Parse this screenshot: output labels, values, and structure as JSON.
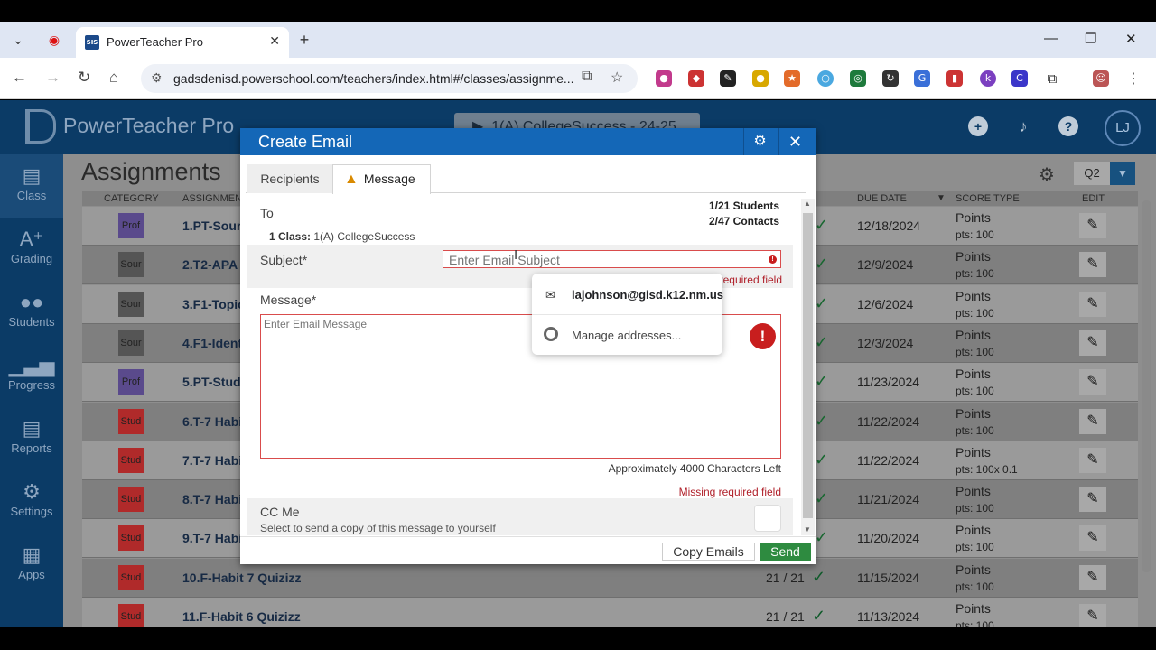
{
  "browser": {
    "tab_title": "PowerTeacher Pro",
    "favicon_text": "SIS",
    "url": "gadsdenisd.powerschool.com/teachers/index.html#/classes/assignme..."
  },
  "app": {
    "brand": "PowerTeacher Pro",
    "class_selector": "1(A) CollegeSuccess - 24-25",
    "avatar_initials": "LJ",
    "page_title": "Assignments",
    "quarter": "Q2",
    "nav": [
      {
        "label": "Class",
        "icon": "class-icon"
      },
      {
        "label": "Grading",
        "icon": "grading-icon"
      },
      {
        "label": "Students",
        "icon": "students-icon"
      },
      {
        "label": "Progress",
        "icon": "progress-icon"
      },
      {
        "label": "Reports",
        "icon": "reports-icon"
      },
      {
        "label": "Settings",
        "icon": "settings-icon"
      },
      {
        "label": "Apps",
        "icon": "apps-icon"
      }
    ],
    "columns": {
      "category": "CATEGORY",
      "assignment": "ASSIGNMENT",
      "due_date": "DUE DATE",
      "score_type": "SCORE TYPE",
      "edit": "EDIT"
    },
    "assignments": [
      {
        "cat": "Prof",
        "cat_color": "#5a4a8c",
        "name": "1.PT-Sour",
        "done": "",
        "due": "12/18/2024",
        "stype": "Points",
        "pts": "pts: 100"
      },
      {
        "cat": "Sour",
        "cat_color": "#555555",
        "name": "2.T2-APA",
        "done": "",
        "due": "12/9/2024",
        "stype": "Points",
        "pts": "pts: 100"
      },
      {
        "cat": "Sour",
        "cat_color": "#555555",
        "name": "3.F1-Topic",
        "done": "",
        "due": "12/6/2024",
        "stype": "Points",
        "pts": "pts: 100"
      },
      {
        "cat": "Sour",
        "cat_color": "#555555",
        "name": "4.F1-Ident",
        "done": "",
        "due": "12/3/2024",
        "stype": "Points",
        "pts": "pts: 100"
      },
      {
        "cat": "Prof",
        "cat_color": "#5a4a8c",
        "name": "5.PT-Stud",
        "done": "",
        "due": "11/23/2024",
        "stype": "Points",
        "pts": "pts: 100"
      },
      {
        "cat": "Stud",
        "cat_color": "#b02a2a",
        "name": "6.T-7 Habi",
        "done": "",
        "due": "11/22/2024",
        "stype": "Points",
        "pts": "pts: 100"
      },
      {
        "cat": "Stud",
        "cat_color": "#b02a2a",
        "name": "7.T-7 Habi",
        "done": "",
        "due": "11/22/2024",
        "stype": "Points",
        "pts": "pts: 100x 0.1"
      },
      {
        "cat": "Stud",
        "cat_color": "#b02a2a",
        "name": "8.T-7 Habi",
        "done": "",
        "due": "11/21/2024",
        "stype": "Points",
        "pts": "pts: 100"
      },
      {
        "cat": "Stud",
        "cat_color": "#b02a2a",
        "name": "9.T-7 Habi",
        "done": "",
        "due": "11/20/2024",
        "stype": "Points",
        "pts": "pts: 100"
      },
      {
        "cat": "Stud",
        "cat_color": "#b02a2a",
        "name": "10.F-Habit 7 Quizizz",
        "done": "21 / 21",
        "due": "11/15/2024",
        "stype": "Points",
        "pts": "pts: 100"
      },
      {
        "cat": "Stud",
        "cat_color": "#b02a2a",
        "name": "11.F-Habit 6 Quizizz",
        "done": "21 / 21",
        "due": "11/13/2024",
        "stype": "Points",
        "pts": "pts: 100"
      }
    ]
  },
  "modal": {
    "title": "Create Email",
    "tabs": {
      "recipients": "Recipients",
      "message": "Message"
    },
    "to_label": "To",
    "students_count": "1/21 Students",
    "contacts_count": "2/47 Contacts",
    "class_prefix": "1 Class:",
    "class_name": "1(A) CollegeSuccess",
    "subject_label": "Subject*",
    "subject_placeholder": "Enter Email Subject",
    "subject_error": "required field",
    "message_label": "Message*",
    "message_placeholder": "Enter Email Message",
    "chars_left": "Approximately 4000 Characters Left",
    "message_error": "Missing required field",
    "cc_label": "CC Me",
    "cc_desc": "Select to send a copy of this message to yourself",
    "copy_emails": "Copy Emails",
    "send": "Send"
  },
  "autofill": {
    "email": "lajohnson@gisd.k12.nm.us",
    "manage": "Manage addresses..."
  }
}
